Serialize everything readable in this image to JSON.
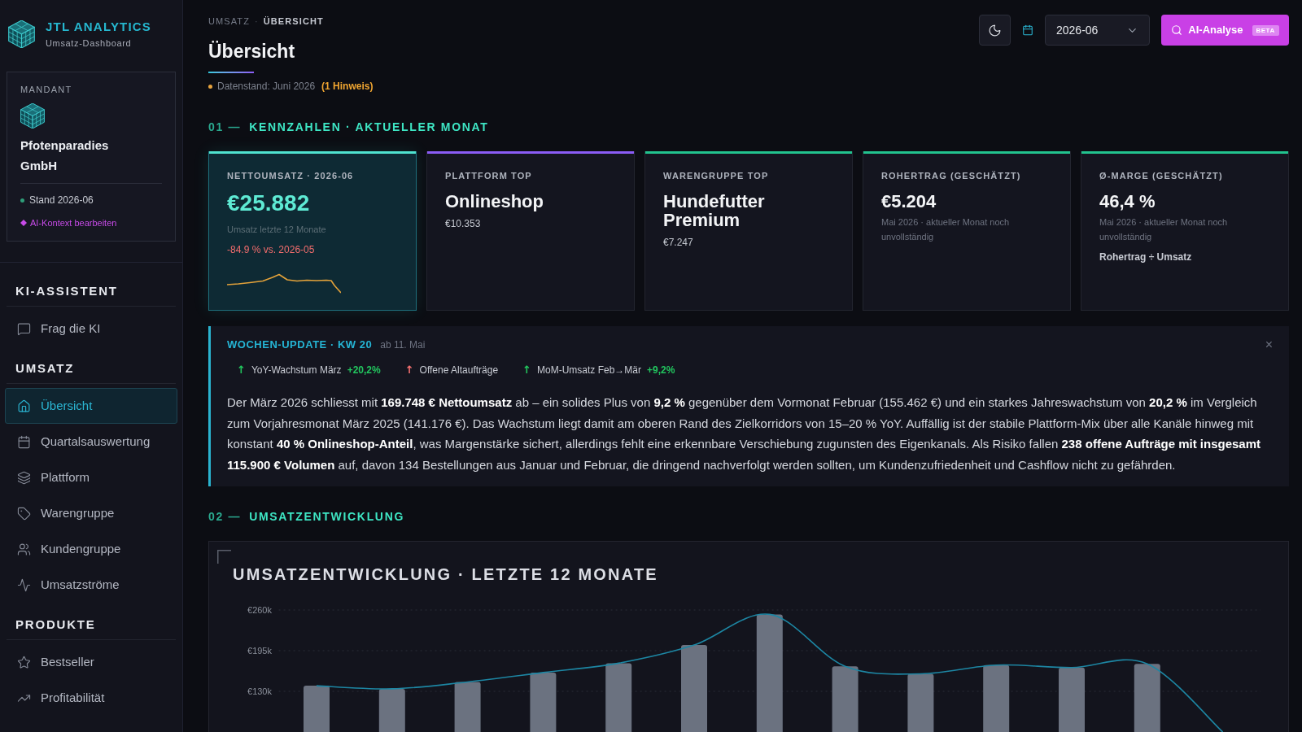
{
  "sidebar": {
    "brand": {
      "title": "JTL ANALYTICS",
      "subtitle": "Umsatz-Dashboard"
    },
    "tenant": {
      "label": "MANDANT",
      "name": "Pfotenparadies GmbH",
      "status": "Stand 2026-06",
      "action": "AI-Kontext bearbeiten"
    },
    "sections": [
      {
        "title": "KI-ASSISTENT",
        "items": [
          {
            "label": "Frag die KI",
            "selected": false
          }
        ]
      },
      {
        "title": "UMSATZ",
        "items": [
          {
            "label": "Übersicht",
            "selected": true
          },
          {
            "label": "Quartalsauswertung",
            "selected": false
          },
          {
            "label": "Plattform",
            "selected": false
          },
          {
            "label": "Warengruppe",
            "selected": false
          },
          {
            "label": "Kundengruppe",
            "selected": false
          },
          {
            "label": "Umsatzströme",
            "selected": false
          }
        ]
      },
      {
        "title": "PRODUKTE",
        "items": [
          {
            "label": "Bestseller",
            "selected": false
          },
          {
            "label": "Profitabilität",
            "selected": false
          }
        ]
      }
    ]
  },
  "header": {
    "breadcrumb": {
      "items": [
        "UMSATZ",
        "ÜBERSICHT"
      ],
      "separator": "·"
    },
    "title": "Übersicht",
    "data_status": {
      "text": "Datenstand: Juni 2026",
      "notice": "(1 Hinweis)"
    },
    "period_select": {
      "value": "2026-06"
    },
    "ai_button": {
      "label": "AI-Analyse",
      "badge": "BETA"
    }
  },
  "kpi_section": {
    "number": "01 —",
    "title": "KENNZAHLEN · AKTUELLER MONAT",
    "cards": [
      {
        "kind": "trend",
        "highlighted": true,
        "color": "#4fe3d0",
        "label": "NETTOUMSATZ · 2026-06",
        "value": "€25.882",
        "caption": "Umsatz letzte 12 Monate",
        "change": "-84.9 % vs. 2026-05"
      },
      {
        "kind": "stat",
        "highlighted": false,
        "color": "#8b5cf6",
        "label": "PLATTFORM TOP",
        "value": "Onlineshop",
        "amount": "€10.353"
      },
      {
        "kind": "stat",
        "highlighted": false,
        "color": "#22c38e",
        "label": "WARENGRUPPE TOP",
        "value": "Hundefutter Premium",
        "amount": "€7.247"
      },
      {
        "kind": "stat",
        "highlighted": false,
        "color": "#22c38e",
        "label": "ROHERTRAG (GESCHÄTZT)",
        "value": "€5.204",
        "note": "Mai 2026 · aktueller Monat noch unvollständig"
      },
      {
        "kind": "stat",
        "highlighted": false,
        "color": "#22c38e",
        "label": "Ø-MARGE (GESCHÄTZT)",
        "value": "46,4 %",
        "note": "Mai 2026 · aktueller Monat noch unvollständig",
        "formula": "Rohertrag ÷ Umsatz"
      }
    ]
  },
  "weekly_update": {
    "title": "WOCHEN-UPDATE · KW 20",
    "date": "ab 11. Mai",
    "close": "×",
    "highlights": [
      {
        "arrow": "↑",
        "label": "YoY-Wachstum März",
        "value": "+20,2%",
        "color": "#22c55e"
      },
      {
        "arrow": "↑",
        "label": "Offene Altaufträge",
        "color": "#f87171"
      },
      {
        "arrow": "↑",
        "label": "MoM-Umsatz Feb→Mär",
        "value": "+9,2%",
        "color": "#22c55e"
      }
    ],
    "text": "Der März 2026 schliesst mit **169.748 € Nettoumsatz** ab – ein solides Plus von **9,2 %** gegenüber dem Vormonat Februar (155.462 €) und ein starkes Jahreswachstum von **20,2 %** im Vergleich zum Vorjahresmonat März 2025 (141.176 €). Das Wachstum liegt damit am oberen Rand des Zielkorridors von 15–20 % YoY. Auffällig ist der stabile Plattform-Mix über alle Kanäle hinweg mit konstant **40 % Onlineshop-Anteil**, was Margenstärke sichert, allerdings fehlt eine erkennbare Verschiebung zugunsten des Eigenkanals. Als Risiko fallen **238 offene Aufträge mit insgesamt 115.900 € Volumen** auf, davon 134 Bestellungen aus Januar und Februar, die dringend nachverfolgt werden sollten, um Kundenzufriedenheit und Cashflow nicht zu gefährden."
  },
  "trend_section": {
    "number": "02 —",
    "title": "UMSATZENTWICKLUNG",
    "chart_data": {
      "type": "bar",
      "title": "UMSATZENTWICKLUNG · LETZTE 12 MONATE",
      "ylim": [
        65000,
        260000
      ],
      "yticks": [
        {
          "value": 130000,
          "label": "€130k"
        },
        {
          "value": 195000,
          "label": "€195k"
        },
        {
          "value": 260000,
          "label": "€260k"
        }
      ],
      "grid": true,
      "series": [
        {
          "color": "#6b7280",
          "values": [
            139000,
            134000,
            145000,
            160000,
            175000,
            204000,
            253000,
            170000,
            158000,
            172000,
            168000,
            174000
          ]
        },
        {
          "type": "line",
          "color": "#1d86a3",
          "values": [
            139000,
            134000,
            145000,
            160000,
            175000,
            204000,
            253000,
            170000,
            158000,
            172000,
            168000,
            174000,
            65000
          ]
        }
      ]
    }
  }
}
